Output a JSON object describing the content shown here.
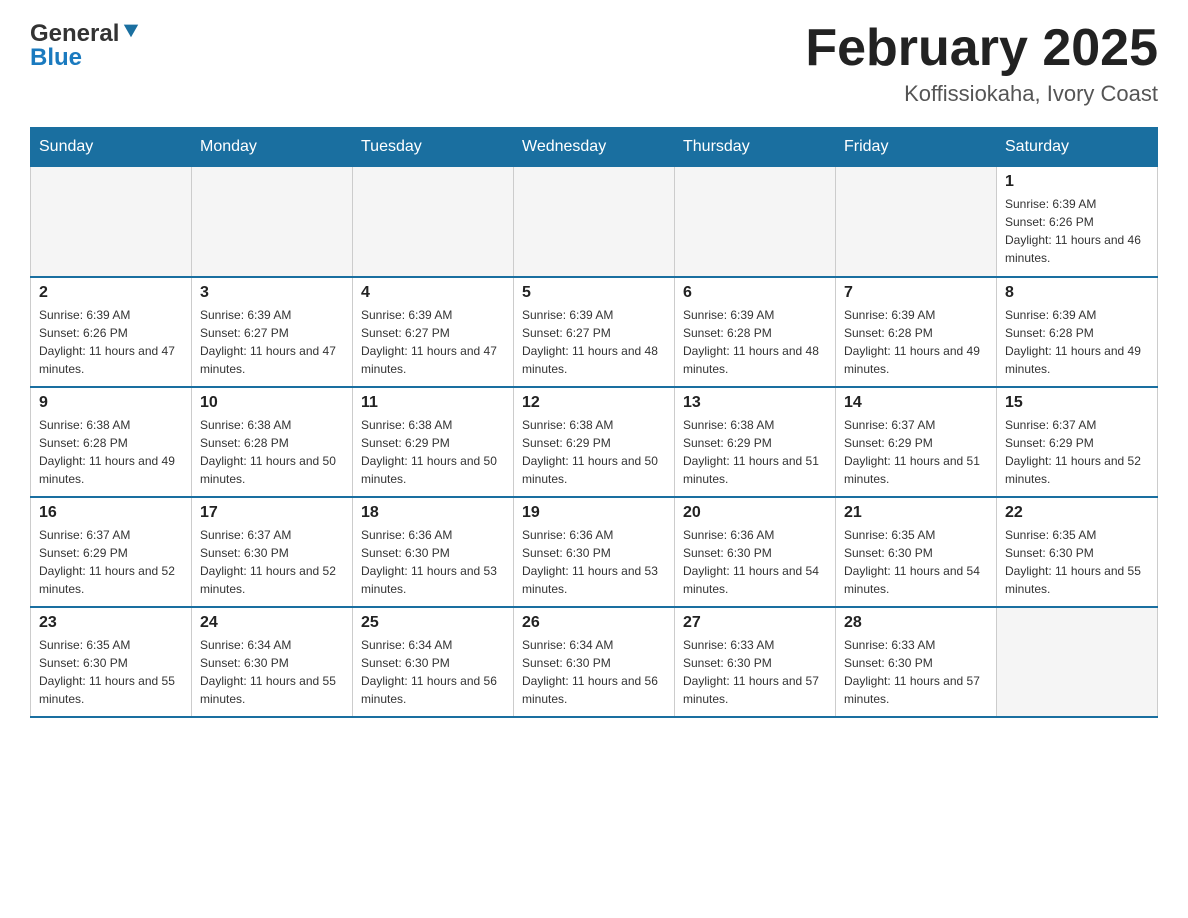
{
  "header": {
    "logo": {
      "general": "General",
      "blue": "Blue"
    },
    "title": "February 2025",
    "subtitle": "Koffissiokaha, Ivory Coast"
  },
  "calendar": {
    "weekdays": [
      "Sunday",
      "Monday",
      "Tuesday",
      "Wednesday",
      "Thursday",
      "Friday",
      "Saturday"
    ],
    "weeks": [
      [
        {
          "day": "",
          "sunrise": "",
          "sunset": "",
          "daylight": "",
          "empty": true
        },
        {
          "day": "",
          "sunrise": "",
          "sunset": "",
          "daylight": "",
          "empty": true
        },
        {
          "day": "",
          "sunrise": "",
          "sunset": "",
          "daylight": "",
          "empty": true
        },
        {
          "day": "",
          "sunrise": "",
          "sunset": "",
          "daylight": "",
          "empty": true
        },
        {
          "day": "",
          "sunrise": "",
          "sunset": "",
          "daylight": "",
          "empty": true
        },
        {
          "day": "",
          "sunrise": "",
          "sunset": "",
          "daylight": "",
          "empty": true
        },
        {
          "day": "1",
          "sunrise": "Sunrise: 6:39 AM",
          "sunset": "Sunset: 6:26 PM",
          "daylight": "Daylight: 11 hours and 46 minutes.",
          "empty": false
        }
      ],
      [
        {
          "day": "2",
          "sunrise": "Sunrise: 6:39 AM",
          "sunset": "Sunset: 6:26 PM",
          "daylight": "Daylight: 11 hours and 47 minutes.",
          "empty": false
        },
        {
          "day": "3",
          "sunrise": "Sunrise: 6:39 AM",
          "sunset": "Sunset: 6:27 PM",
          "daylight": "Daylight: 11 hours and 47 minutes.",
          "empty": false
        },
        {
          "day": "4",
          "sunrise": "Sunrise: 6:39 AM",
          "sunset": "Sunset: 6:27 PM",
          "daylight": "Daylight: 11 hours and 47 minutes.",
          "empty": false
        },
        {
          "day": "5",
          "sunrise": "Sunrise: 6:39 AM",
          "sunset": "Sunset: 6:27 PM",
          "daylight": "Daylight: 11 hours and 48 minutes.",
          "empty": false
        },
        {
          "day": "6",
          "sunrise": "Sunrise: 6:39 AM",
          "sunset": "Sunset: 6:28 PM",
          "daylight": "Daylight: 11 hours and 48 minutes.",
          "empty": false
        },
        {
          "day": "7",
          "sunrise": "Sunrise: 6:39 AM",
          "sunset": "Sunset: 6:28 PM",
          "daylight": "Daylight: 11 hours and 49 minutes.",
          "empty": false
        },
        {
          "day": "8",
          "sunrise": "Sunrise: 6:39 AM",
          "sunset": "Sunset: 6:28 PM",
          "daylight": "Daylight: 11 hours and 49 minutes.",
          "empty": false
        }
      ],
      [
        {
          "day": "9",
          "sunrise": "Sunrise: 6:38 AM",
          "sunset": "Sunset: 6:28 PM",
          "daylight": "Daylight: 11 hours and 49 minutes.",
          "empty": false
        },
        {
          "day": "10",
          "sunrise": "Sunrise: 6:38 AM",
          "sunset": "Sunset: 6:28 PM",
          "daylight": "Daylight: 11 hours and 50 minutes.",
          "empty": false
        },
        {
          "day": "11",
          "sunrise": "Sunrise: 6:38 AM",
          "sunset": "Sunset: 6:29 PM",
          "daylight": "Daylight: 11 hours and 50 minutes.",
          "empty": false
        },
        {
          "day": "12",
          "sunrise": "Sunrise: 6:38 AM",
          "sunset": "Sunset: 6:29 PM",
          "daylight": "Daylight: 11 hours and 50 minutes.",
          "empty": false
        },
        {
          "day": "13",
          "sunrise": "Sunrise: 6:38 AM",
          "sunset": "Sunset: 6:29 PM",
          "daylight": "Daylight: 11 hours and 51 minutes.",
          "empty": false
        },
        {
          "day": "14",
          "sunrise": "Sunrise: 6:37 AM",
          "sunset": "Sunset: 6:29 PM",
          "daylight": "Daylight: 11 hours and 51 minutes.",
          "empty": false
        },
        {
          "day": "15",
          "sunrise": "Sunrise: 6:37 AM",
          "sunset": "Sunset: 6:29 PM",
          "daylight": "Daylight: 11 hours and 52 minutes.",
          "empty": false
        }
      ],
      [
        {
          "day": "16",
          "sunrise": "Sunrise: 6:37 AM",
          "sunset": "Sunset: 6:29 PM",
          "daylight": "Daylight: 11 hours and 52 minutes.",
          "empty": false
        },
        {
          "day": "17",
          "sunrise": "Sunrise: 6:37 AM",
          "sunset": "Sunset: 6:30 PM",
          "daylight": "Daylight: 11 hours and 52 minutes.",
          "empty": false
        },
        {
          "day": "18",
          "sunrise": "Sunrise: 6:36 AM",
          "sunset": "Sunset: 6:30 PM",
          "daylight": "Daylight: 11 hours and 53 minutes.",
          "empty": false
        },
        {
          "day": "19",
          "sunrise": "Sunrise: 6:36 AM",
          "sunset": "Sunset: 6:30 PM",
          "daylight": "Daylight: 11 hours and 53 minutes.",
          "empty": false
        },
        {
          "day": "20",
          "sunrise": "Sunrise: 6:36 AM",
          "sunset": "Sunset: 6:30 PM",
          "daylight": "Daylight: 11 hours and 54 minutes.",
          "empty": false
        },
        {
          "day": "21",
          "sunrise": "Sunrise: 6:35 AM",
          "sunset": "Sunset: 6:30 PM",
          "daylight": "Daylight: 11 hours and 54 minutes.",
          "empty": false
        },
        {
          "day": "22",
          "sunrise": "Sunrise: 6:35 AM",
          "sunset": "Sunset: 6:30 PM",
          "daylight": "Daylight: 11 hours and 55 minutes.",
          "empty": false
        }
      ],
      [
        {
          "day": "23",
          "sunrise": "Sunrise: 6:35 AM",
          "sunset": "Sunset: 6:30 PM",
          "daylight": "Daylight: 11 hours and 55 minutes.",
          "empty": false
        },
        {
          "day": "24",
          "sunrise": "Sunrise: 6:34 AM",
          "sunset": "Sunset: 6:30 PM",
          "daylight": "Daylight: 11 hours and 55 minutes.",
          "empty": false
        },
        {
          "day": "25",
          "sunrise": "Sunrise: 6:34 AM",
          "sunset": "Sunset: 6:30 PM",
          "daylight": "Daylight: 11 hours and 56 minutes.",
          "empty": false
        },
        {
          "day": "26",
          "sunrise": "Sunrise: 6:34 AM",
          "sunset": "Sunset: 6:30 PM",
          "daylight": "Daylight: 11 hours and 56 minutes.",
          "empty": false
        },
        {
          "day": "27",
          "sunrise": "Sunrise: 6:33 AM",
          "sunset": "Sunset: 6:30 PM",
          "daylight": "Daylight: 11 hours and 57 minutes.",
          "empty": false
        },
        {
          "day": "28",
          "sunrise": "Sunrise: 6:33 AM",
          "sunset": "Sunset: 6:30 PM",
          "daylight": "Daylight: 11 hours and 57 minutes.",
          "empty": false
        },
        {
          "day": "",
          "sunrise": "",
          "sunset": "",
          "daylight": "",
          "empty": true
        }
      ]
    ]
  }
}
